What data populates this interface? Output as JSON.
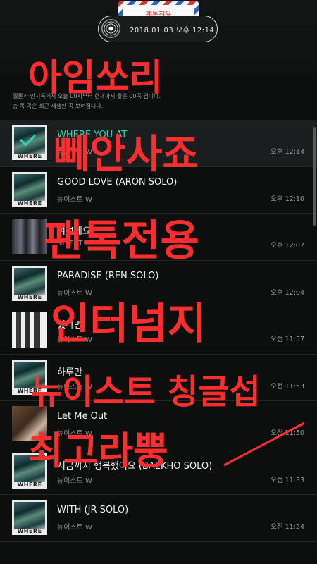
{
  "header": {
    "fan_tag": "팬톡전용",
    "date": "2018.01.03 오후 12:14",
    "notice_line1": "멜론과 안지톡에서 오늘 00시부터 현재까지 들은 00곡 입니다.",
    "notice_line2": "총 목 곡은 최근 재생한 곡 보여집니다."
  },
  "songs": [
    {
      "title": "WHERE YOU AT",
      "artist": "뉴이스트 W",
      "time": "오후 12:14",
      "cover": "where-you-at-cover",
      "cover_text": "WHERE"
    },
    {
      "title": "GOOD LOVE (ARON SOLO)",
      "artist": "뉴이스트 W",
      "time": "오후 12:10",
      "cover": "where-you-at-cover",
      "cover_text": "WHERE"
    },
    {
      "title": "여보세요",
      "artist": "NU'EST",
      "time": "오후 12:07",
      "cover": "group-photo-cover",
      "cover_text": ""
    },
    {
      "title": "PARADISE (REN SOLO)",
      "artist": "뉴이스트 W",
      "time": "오후 12:04",
      "cover": "where-you-at-cover",
      "cover_text": "WHERE"
    },
    {
      "title": "있다면",
      "artist": "뉴이스트 W",
      "time": "오전 11:57",
      "cover": "black-white-cover",
      "cover_text": ""
    },
    {
      "title": "하루만",
      "artist": "뉴이스트 W",
      "time": "오전 11:53",
      "cover": "where-you-at-cover",
      "cover_text": "WHERE"
    },
    {
      "title": "Let Me Out",
      "artist": "뉴이스트 W",
      "time": "오전 11:50",
      "cover": "portrait-cover",
      "cover_text": ""
    },
    {
      "title": "지금까지 행복했어요 (BAEKHO SOLO)",
      "artist": "뉴이스트 W",
      "time": "오전 11:33",
      "cover": "where-you-at-cover",
      "cover_text": "WHERE"
    },
    {
      "title": "WITH (JR SOLO)",
      "artist": "뉴이스트 W",
      "time": "오전 11:24",
      "cover": "where-you-at-cover",
      "cover_text": "WHERE"
    }
  ],
  "graffiti": [
    "아임쏘리",
    "뻬안사죠",
    "팬톡전용",
    "인터넘지",
    "뉴이스트 칭글섭",
    "최고라뿡"
  ],
  "colors": {
    "accent": "#2ed3b7",
    "graffiti": "#ff2d2d",
    "background": "#0d0f0f"
  }
}
